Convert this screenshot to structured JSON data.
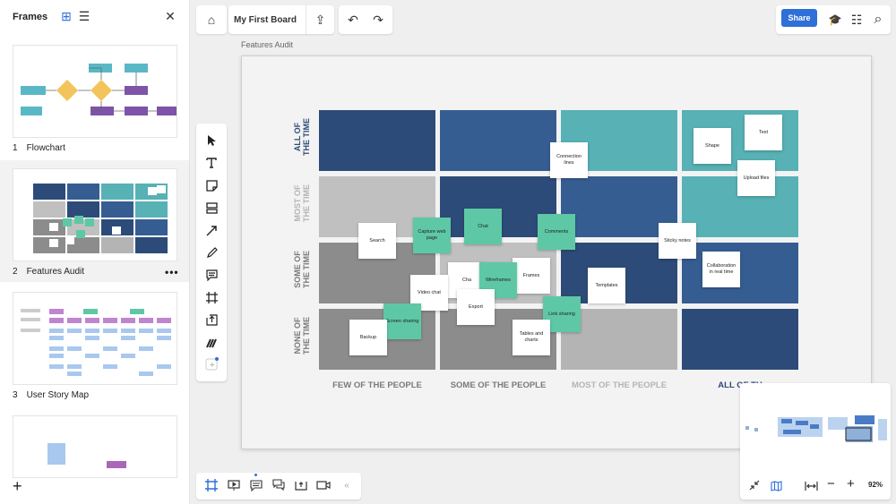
{
  "frames_panel": {
    "title": "Frames",
    "frames": [
      {
        "number": "1",
        "name": "Flowchart"
      },
      {
        "number": "2",
        "name": "Features Audit"
      },
      {
        "number": "3",
        "name": "User Story Map"
      },
      {
        "number": "4",
        "name": ""
      }
    ],
    "more_label": "•••",
    "add_label": "+"
  },
  "toolbar": {
    "board_name": "My First Board",
    "share_label": "Share"
  },
  "icons": {
    "grid": "⊞",
    "list": "☰",
    "close": "✕",
    "home": "⌂",
    "export": "⇪",
    "undo": "↶",
    "redo": "↷",
    "learn": "🎓",
    "settings": "☷",
    "search": "⌕"
  },
  "canvas": {
    "frame_caption": "Features Audit",
    "row_labels": [
      "ALL OF THE TIME",
      "MOST OF THE TIME",
      "SOME OF THE TIME",
      "NONE OF THE TIME"
    ],
    "row_label_lines": [
      [
        "ALL OF",
        "THE TIME"
      ],
      [
        "MOST OF",
        "THE TIME"
      ],
      [
        "SOME OF",
        "THE TIME"
      ],
      [
        "NONE OF",
        "THE TIME"
      ]
    ],
    "col_labels": [
      "FEW OF THE PEOPLE",
      "SOME OF THE PEOPLE",
      "MOST OF THE PEOPLE",
      "ALL OF THE PEOPLE"
    ],
    "col_labels_visible": [
      "FEW OF THE PEOPLE",
      "SOME OF THE PEOPLE",
      "MOST OF THE PEOPLE",
      "ALL OF TH"
    ],
    "notes": [
      {
        "text": "Connection lines",
        "color": "white"
      },
      {
        "text": "Shape",
        "color": "white"
      },
      {
        "text": "Text",
        "color": "white"
      },
      {
        "text": "Upload files",
        "color": "white"
      },
      {
        "text": "Search",
        "color": "white"
      },
      {
        "text": "Capture web page",
        "color": "teal"
      },
      {
        "text": "Chat",
        "color": "teal"
      },
      {
        "text": "Comments",
        "color": "teal"
      },
      {
        "text": "Sticky notes",
        "color": "white"
      },
      {
        "text": "Cha",
        "color": "white"
      },
      {
        "text": "Frames",
        "color": "white"
      },
      {
        "text": "Wireframes",
        "color": "teal"
      },
      {
        "text": "Templates",
        "color": "white"
      },
      {
        "text": "Collaboration in real time",
        "color": "white"
      },
      {
        "text": "Video chat",
        "color": "white"
      },
      {
        "text": "Export",
        "color": "white"
      },
      {
        "text": "Screen sharing",
        "color": "teal"
      },
      {
        "text": "Link sharing",
        "color": "teal"
      },
      {
        "text": "Backup",
        "color": "white"
      },
      {
        "text": "Tables and charts",
        "color": "white"
      }
    ]
  },
  "minimap": {
    "zoom_level": "92%"
  },
  "colors": {
    "accent": "#2e6fd8",
    "navy": "#2d4b78",
    "blue": "#355d91",
    "teal": "#57b1b5",
    "light_gray": "#c0c0c0",
    "dark_gray": "#8c8c8c",
    "mid_gray": "#b4b4b4",
    "note_teal": "#5ec8a6",
    "note_white": "#ffffff"
  }
}
